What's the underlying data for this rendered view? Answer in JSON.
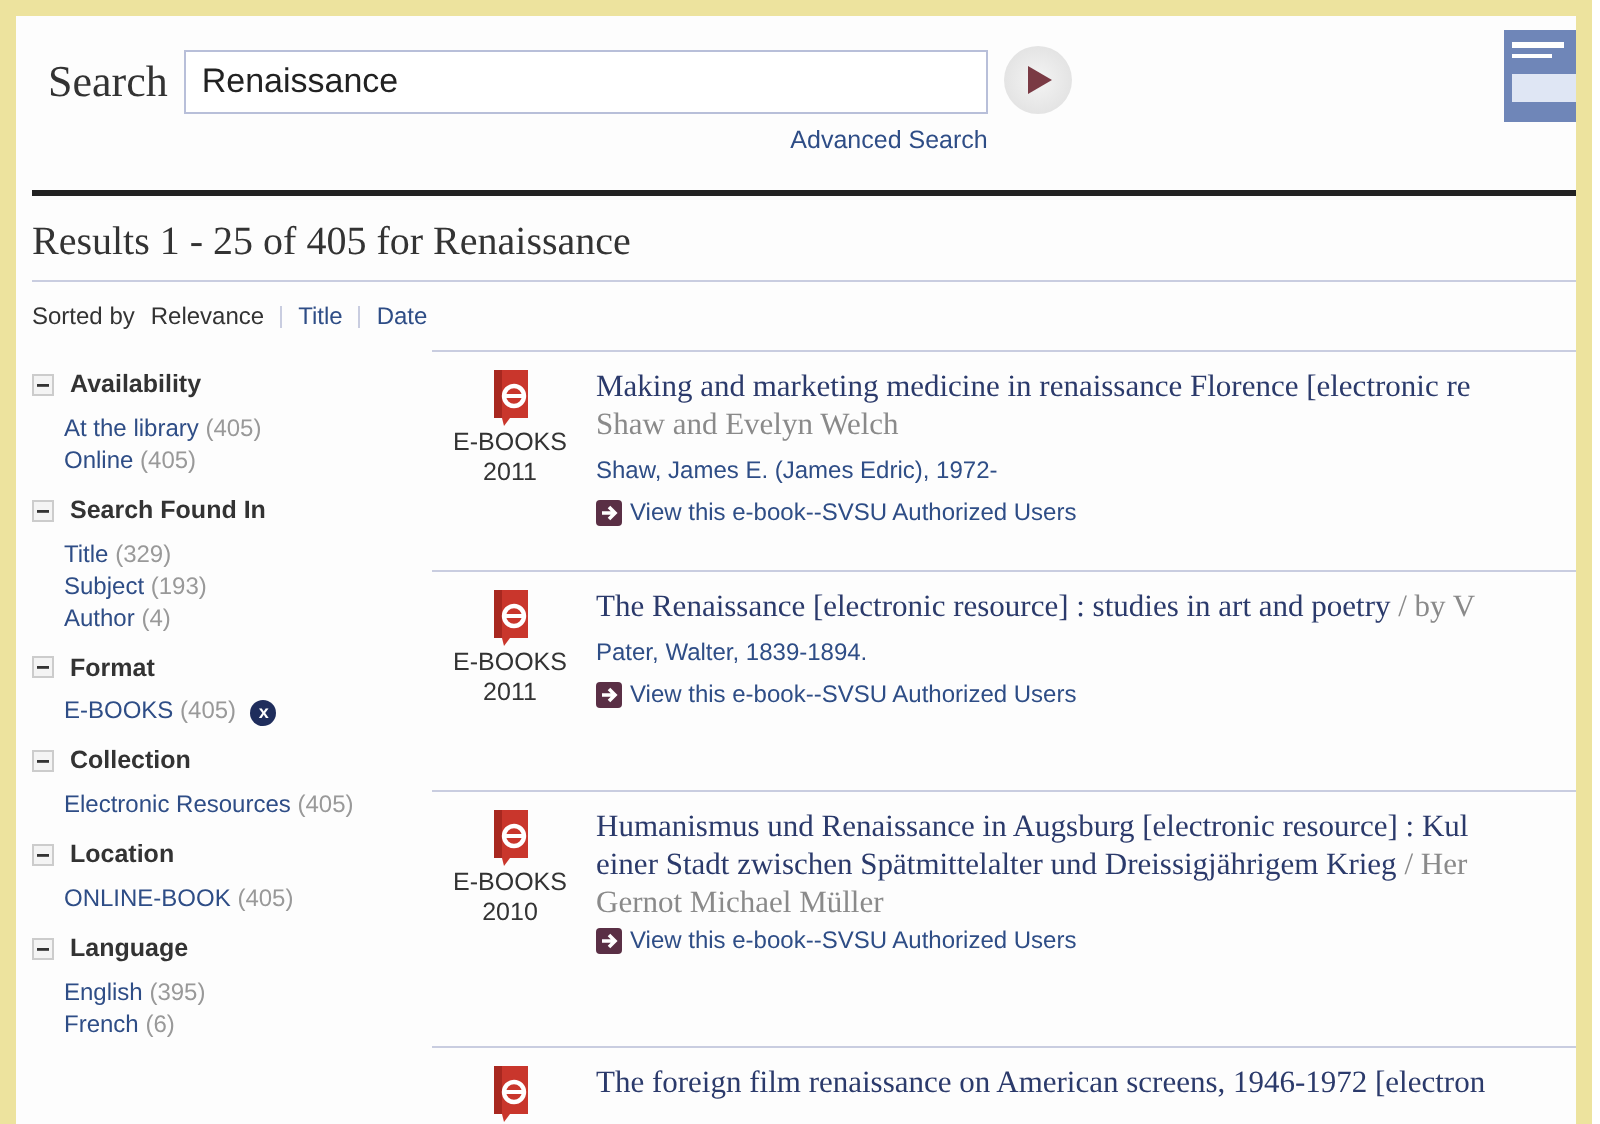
{
  "search": {
    "label": "Search",
    "value": "Renaissance",
    "advanced_link": "Advanced Search"
  },
  "results_heading": "Results 1 - 25 of 405 for Renaissance",
  "sort": {
    "label": "Sorted by",
    "options": [
      {
        "label": "Relevance",
        "selected": true
      },
      {
        "label": "Title",
        "selected": false
      },
      {
        "label": "Date",
        "selected": false
      }
    ]
  },
  "facets": [
    {
      "title": "Availability",
      "expanded": true,
      "items": [
        {
          "label": "At the library",
          "count": "(405)"
        },
        {
          "label": "Online",
          "count": "(405)"
        }
      ]
    },
    {
      "title": "Search Found In",
      "expanded": true,
      "items": [
        {
          "label": "Title",
          "count": "(329)"
        },
        {
          "label": "Subject",
          "count": "(193)"
        },
        {
          "label": "Author",
          "count": "(4)"
        }
      ]
    },
    {
      "title": "Format",
      "expanded": true,
      "items": [
        {
          "label": "E-BOOKS",
          "count": "(405)",
          "applied": true,
          "remove": "x"
        }
      ]
    },
    {
      "title": "Collection",
      "expanded": true,
      "items": [
        {
          "label": "Electronic Resources",
          "count": "(405)"
        }
      ]
    },
    {
      "title": "Location",
      "expanded": true,
      "items": [
        {
          "label": "ONLINE-BOOK",
          "count": "(405)"
        }
      ]
    },
    {
      "title": "Language",
      "expanded": true,
      "items": [
        {
          "label": "English",
          "count": "(395)"
        },
        {
          "label": "French",
          "count": "(6)"
        }
      ]
    }
  ],
  "results": [
    {
      "format": "E-BOOKS",
      "year": "2011",
      "title_lines": [
        [
          {
            "kind": "title",
            "text": "Making and marketing medicine in renaissance Florence [electronic re"
          }
        ],
        [
          {
            "kind": "byline",
            "text": "Shaw and Evelyn Welch"
          }
        ]
      ],
      "author": "Shaw, James E. (James Edric), 1972-",
      "link": "View this e-book--SVSU Authorized Users"
    },
    {
      "format": "E-BOOKS",
      "year": "2011",
      "title_lines": [
        [
          {
            "kind": "title",
            "text": "The Renaissance [electronic resource] : studies in art and poetry"
          },
          {
            "kind": "byline",
            "text": "/ by V"
          }
        ]
      ],
      "author": "Pater, Walter, 1839-1894.",
      "link": "View this e-book--SVSU Authorized Users"
    },
    {
      "format": "E-BOOKS",
      "year": "2010",
      "title_lines": [
        [
          {
            "kind": "title",
            "text": "Humanismus und Renaissance in Augsburg [electronic resource] : Kul"
          }
        ],
        [
          {
            "kind": "title",
            "text": "einer Stadt zwischen Spätmittelalter und Dreissigjährigem Krieg"
          },
          {
            "kind": "byline",
            "text": "/ Her"
          }
        ],
        [
          {
            "kind": "byline",
            "text": "Gernot Michael Müller"
          }
        ]
      ],
      "link": "View this e-book--SVSU Authorized Users"
    },
    {
      "title_lines": [
        [
          {
            "kind": "title",
            "text": "The foreign film renaissance on American screens, 1946-1972 [electron"
          }
        ]
      ]
    }
  ]
}
